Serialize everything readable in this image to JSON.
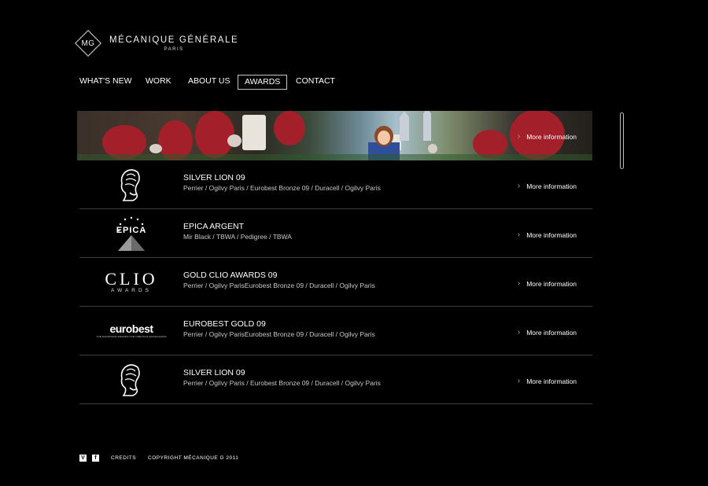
{
  "brand": {
    "mark": "MG",
    "name": "MÉCANIQUE GÉNÉRALE",
    "city": "PARIS"
  },
  "nav": {
    "items": [
      {
        "label": "WHAT'S NEW"
      },
      {
        "label": "WORK"
      },
      {
        "label": "ABOUT US"
      },
      {
        "label": "AWARDS",
        "active": true
      },
      {
        "label": "CONTACT"
      }
    ]
  },
  "banner": {
    "more_label": "More information"
  },
  "awards": [
    {
      "logo": "cannes-lion-icon",
      "title": "SILVER LION 09",
      "subtitle": "Perrier / Ogilvy Paris / Eurobest Bronze 09 / Duracell / Ogilvy Paris",
      "more_label": "More information"
    },
    {
      "logo": "epica-logo",
      "logo_text": "EPICA",
      "title": "EPICA ARGENT",
      "subtitle": "Mir Black / TBWA  / Pedigree / TBWA",
      "more_label": "More information"
    },
    {
      "logo": "clio-logo",
      "logo_text": "CLIO",
      "logo_subtext": "AWARDS",
      "title": "GOLD CLIO AWARDS 09",
      "subtitle": "Perrier / Ogilvy ParisEurobest Bronze 09 / Duracell / Ogilvy Paris",
      "more_label": "More information"
    },
    {
      "logo": "eurobest-logo",
      "logo_text": "eurobest",
      "logo_subtext": "THE EUROPEAN AWARDS FOR CREATIVE EXCELLENCE",
      "title": "EUROBEST GOLD 09",
      "subtitle": "Perrier / Ogilvy ParisEurobest Bronze 09 / Duracell / Ogilvy Paris",
      "more_label": "More information"
    },
    {
      "logo": "cannes-lion-icon",
      "title": "SILVER LION 09",
      "subtitle": "Perrier / Ogilvy Paris / Eurobest Bronze 09 / Duracell / Ogilvy Paris",
      "more_label": "More information"
    }
  ],
  "footer": {
    "social": [
      {
        "icon": "vimeo-icon",
        "glyph": "V"
      },
      {
        "icon": "facebook-icon",
        "glyph": "f"
      }
    ],
    "credits_label": "CREDITS",
    "copyright": "COPYRIGHT  MÉCANIQUE G 2011"
  }
}
